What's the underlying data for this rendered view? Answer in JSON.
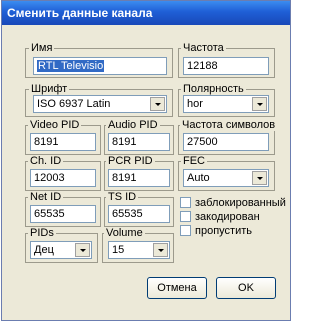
{
  "title": "Сменить данные канала",
  "name": {
    "label": "Имя",
    "value": "RTL Televisio"
  },
  "frequency": {
    "label": "Частота",
    "value": "12188"
  },
  "font": {
    "label": "Шрифт",
    "value": "ISO 6937 Latin"
  },
  "polarity": {
    "label": "Полярность",
    "value": "hor"
  },
  "video_pid": {
    "label": "Video PID",
    "value": "8191"
  },
  "audio_pid": {
    "label": "Audio PID",
    "value": "8191"
  },
  "symbol_rate": {
    "label": "Частота символов",
    "value": "27500"
  },
  "ch_id": {
    "label": "Ch. ID",
    "value": "12003"
  },
  "pcr_pid": {
    "label": "PCR PID",
    "value": "8191"
  },
  "fec": {
    "label": "FEC",
    "value": "Auto"
  },
  "net_id": {
    "label": "Net ID",
    "value": "65535"
  },
  "ts_id": {
    "label": "TS ID",
    "value": "65535"
  },
  "pids": {
    "label": "PIDs",
    "value": "Дец"
  },
  "volume": {
    "label": "Volume",
    "value": "15"
  },
  "checks": {
    "locked": "заблокированный",
    "encoded": "закодирован",
    "skip": "пропустить"
  },
  "buttons": {
    "cancel": "Отмена",
    "ok": "OK"
  }
}
